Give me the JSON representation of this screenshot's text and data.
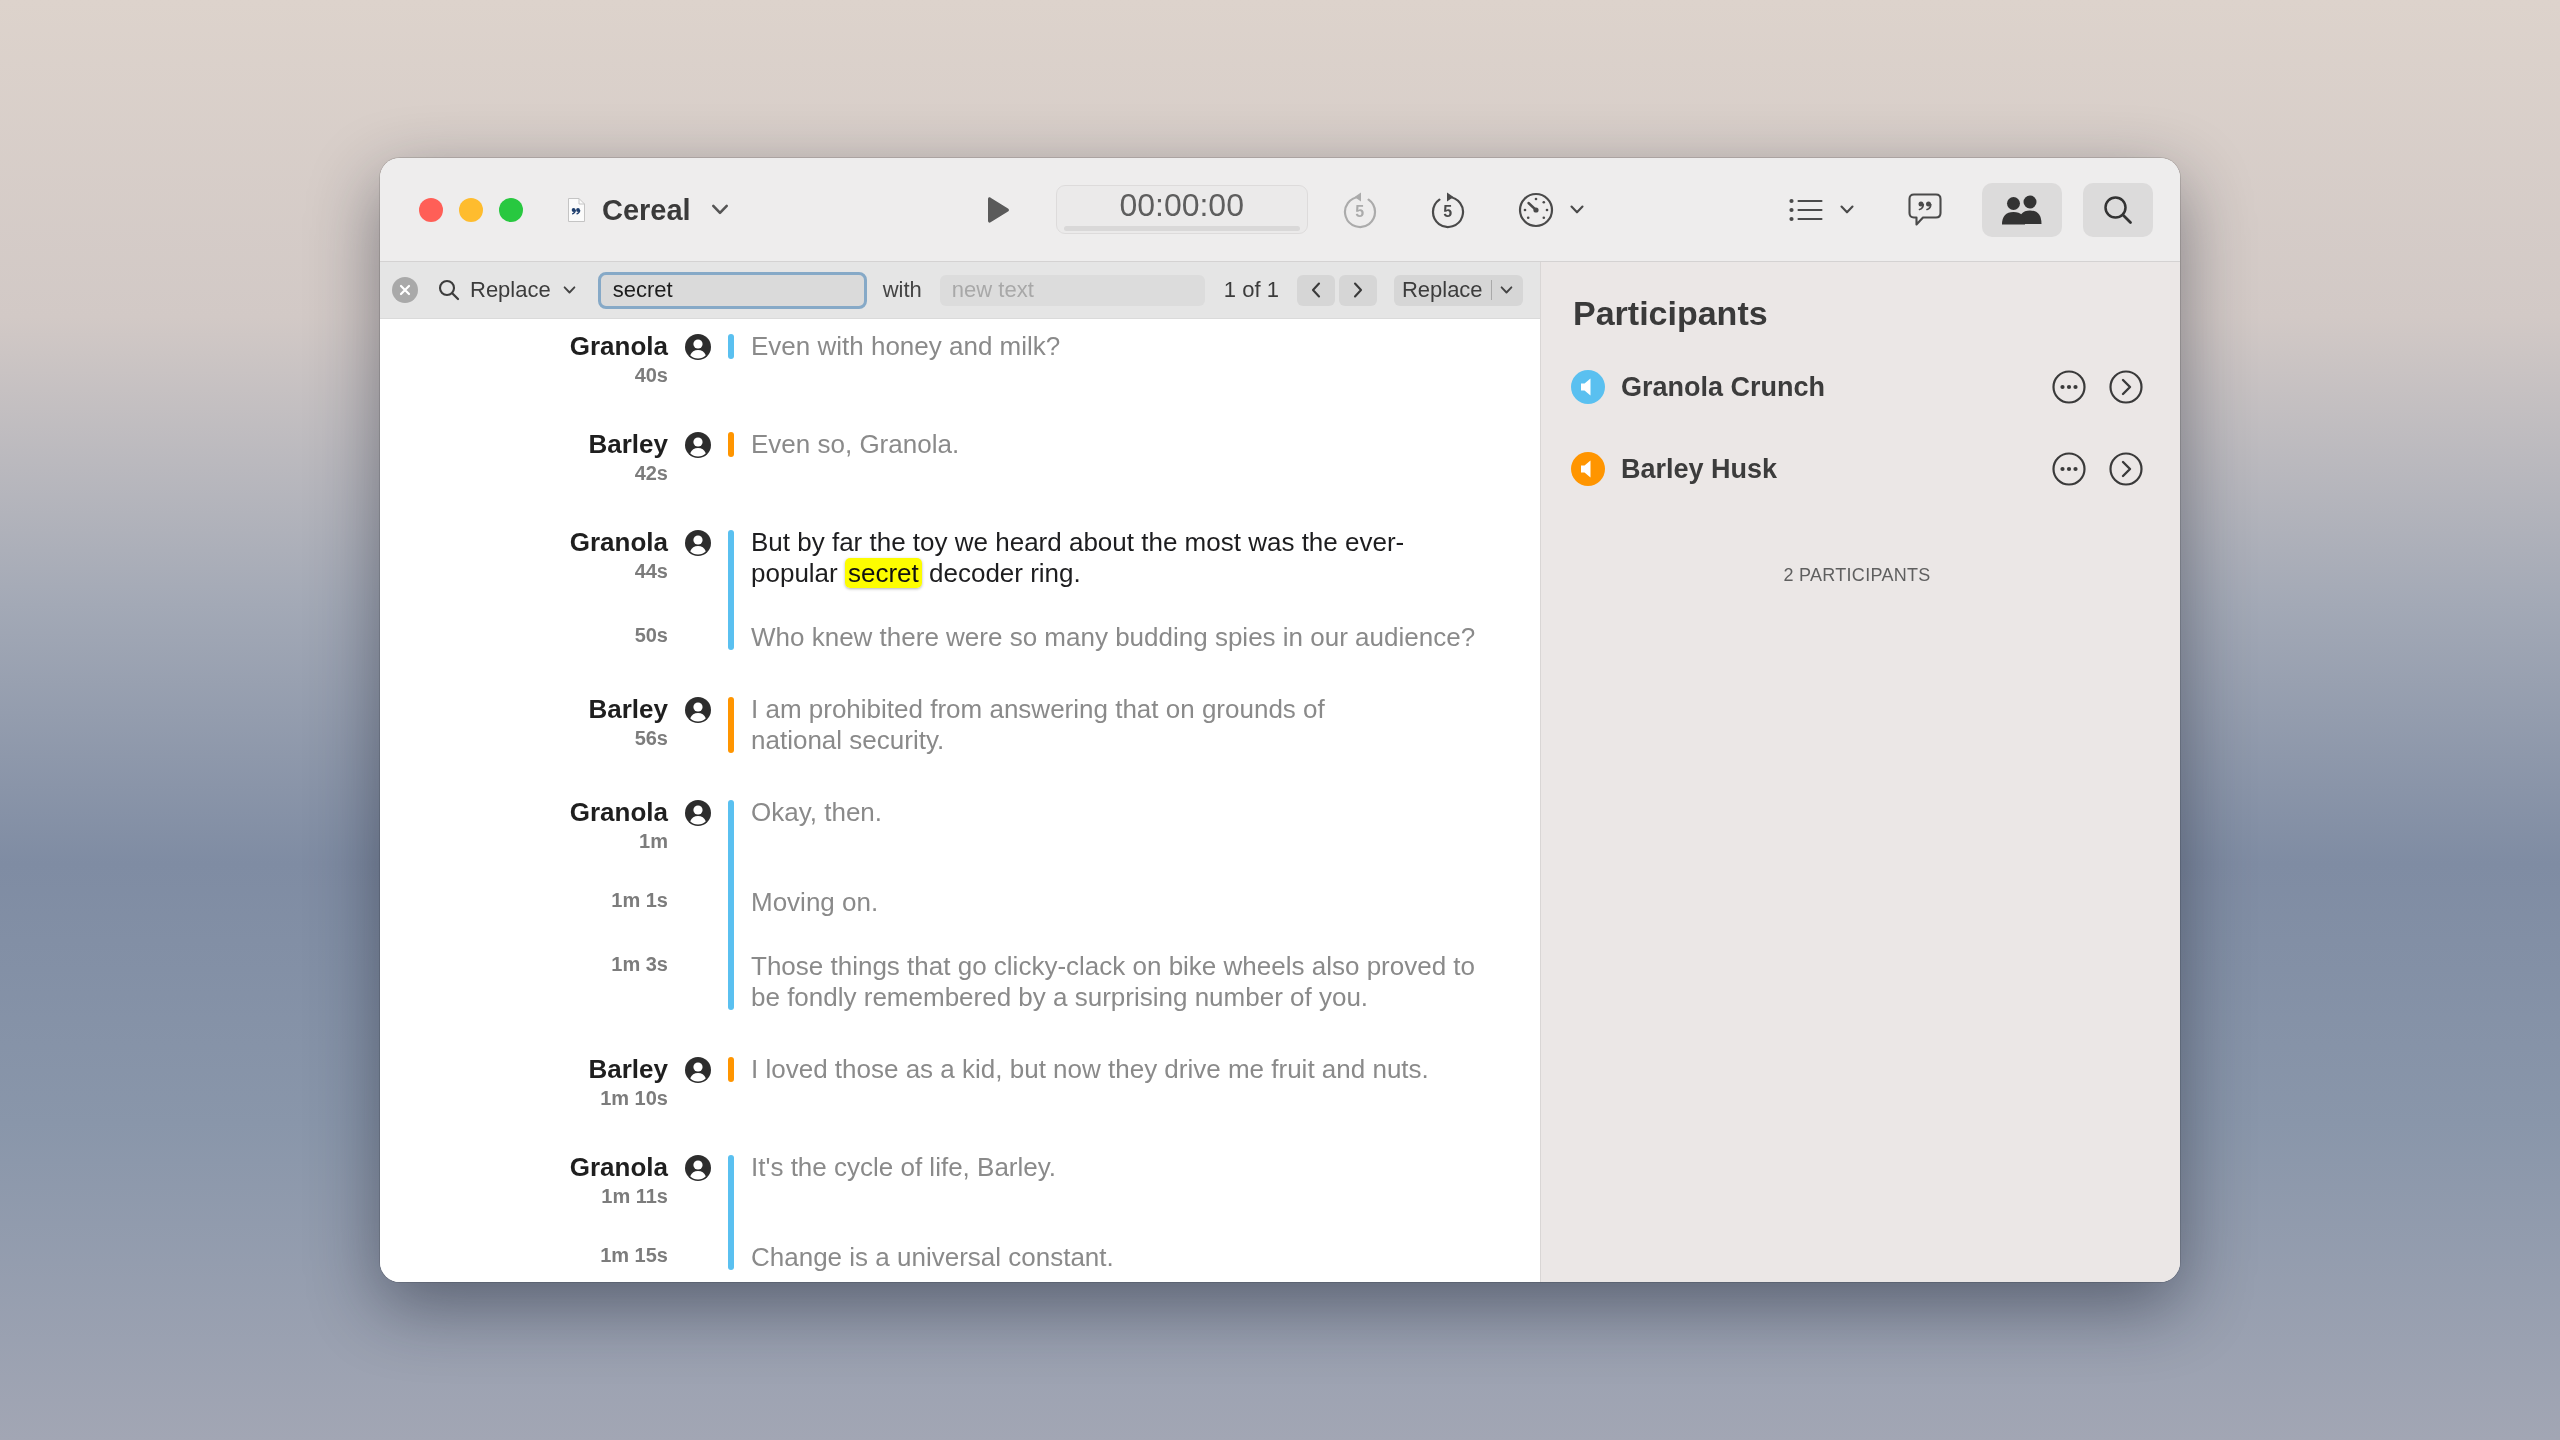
{
  "window": {
    "title": "Cereal"
  },
  "toolbar": {
    "timer": "00:00:00",
    "rewind": {
      "label": "5",
      "disabled": true
    },
    "fast_forward": {
      "label": "5",
      "disabled": false
    },
    "participants_toggle": {
      "selected": true
    },
    "search_toggle": {
      "selected": true
    }
  },
  "search_bar": {
    "mode": "Replace",
    "query": {
      "value": "secret",
      "focused": true
    },
    "with_label": "with",
    "replacement": {
      "placeholder": "new text"
    },
    "match_count": "1 of 1",
    "replace_button": "Replace"
  },
  "transcript": [
    {
      "speaker": "Granola",
      "color": "#5ac0f0",
      "segments": [
        {
          "time": "40s",
          "current": false,
          "text": "Even with honey and milk?"
        }
      ]
    },
    {
      "speaker": "Barley",
      "color": "#ff9500",
      "segments": [
        {
          "time": "42s",
          "current": false,
          "text": "Even so, Granola."
        }
      ]
    },
    {
      "speaker": "Granola",
      "color": "#5ac0f0",
      "segments": [
        {
          "time": "44s",
          "current": true,
          "text": "But by far the toy we heard about the most was the ever-popular ",
          "match": "secret",
          "rest": " decoder ring."
        },
        {
          "time": "50s",
          "current": false,
          "text": "Who knew there were so many budding spies in our audience?"
        }
      ]
    },
    {
      "speaker": "Barley",
      "color": "#ff9500",
      "segments": [
        {
          "time": "56s",
          "current": false,
          "text": "I am prohibited from answering that on grounds of\nnational security."
        }
      ]
    },
    {
      "speaker": "Granola",
      "color": "#5ac0f0",
      "segments": [
        {
          "time": "1m",
          "current": false,
          "text": "Okay, then."
        },
        {
          "time": "1m 1s",
          "current": false,
          "text": "Moving on."
        },
        {
          "time": "1m 3s",
          "current": false,
          "text": "Those things that go clicky-clack on bike wheels also proved to be fondly remembered by a surprising number of you."
        }
      ]
    },
    {
      "speaker": "Barley",
      "color": "#ff9500",
      "segments": [
        {
          "time": "1m 10s",
          "current": false,
          "text": "I loved those as a kid, but now they drive me fruit and nuts."
        }
      ]
    },
    {
      "speaker": "Granola",
      "color": "#5ac0f0",
      "segments": [
        {
          "time": "1m 11s",
          "current": false,
          "text": "It's the cycle of life, Barley."
        },
        {
          "time": "1m 15s",
          "current": false,
          "text": "Change is a universal constant."
        }
      ]
    }
  ],
  "participants": {
    "title": "Participants",
    "items": [
      {
        "name": "Granola Crunch",
        "color": "#5ac0f0"
      },
      {
        "name": "Barley Husk",
        "color": "#ff9500"
      }
    ],
    "count": "2 PARTICIPANTS"
  }
}
